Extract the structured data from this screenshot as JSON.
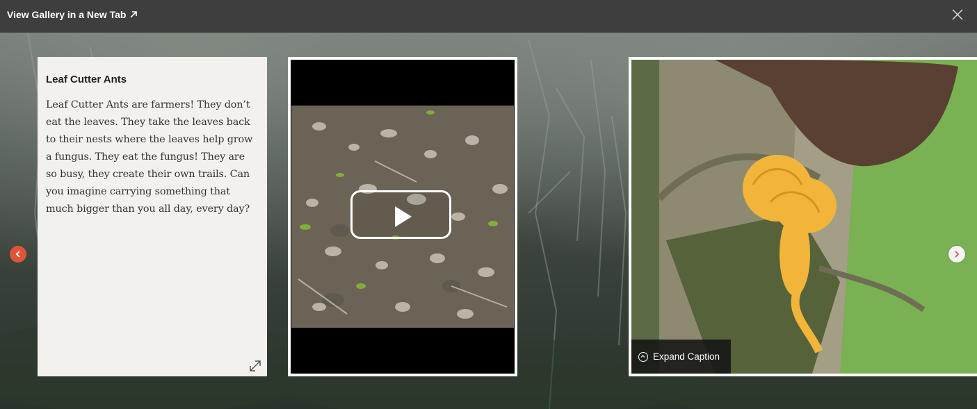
{
  "header": {
    "gallery_link_label": "View Gallery in a New Tab",
    "gallery_link_icon": "external-arrow-icon",
    "close_icon": "close-icon"
  },
  "text_card": {
    "title": "Leaf Cutter Ants",
    "body": "Leaf Cutter Ants are farmers! They don’t eat the leaves. They take the leaves back to their nests where the leaves help grow a fungus. They eat the fungus! They are so busy, they create their own trails. Can you imagine carrying something that much bigger than you all day, every day?",
    "expand_icon": "expand-arrows-icon"
  },
  "video_card": {
    "play_icon": "play-icon"
  },
  "image_card": {
    "caption_toggle_label": "Expand Caption",
    "caption_icon": "chevron-up-circle-icon"
  },
  "navigation": {
    "prev_icon": "chevron-left-icon",
    "next_icon": "chevron-right-icon"
  },
  "colors": {
    "top_bar": "#3e3e3e",
    "prev_button": "#e0553a",
    "next_arrow": "#e0553a",
    "text_card_bg": "#f2f1ee"
  }
}
